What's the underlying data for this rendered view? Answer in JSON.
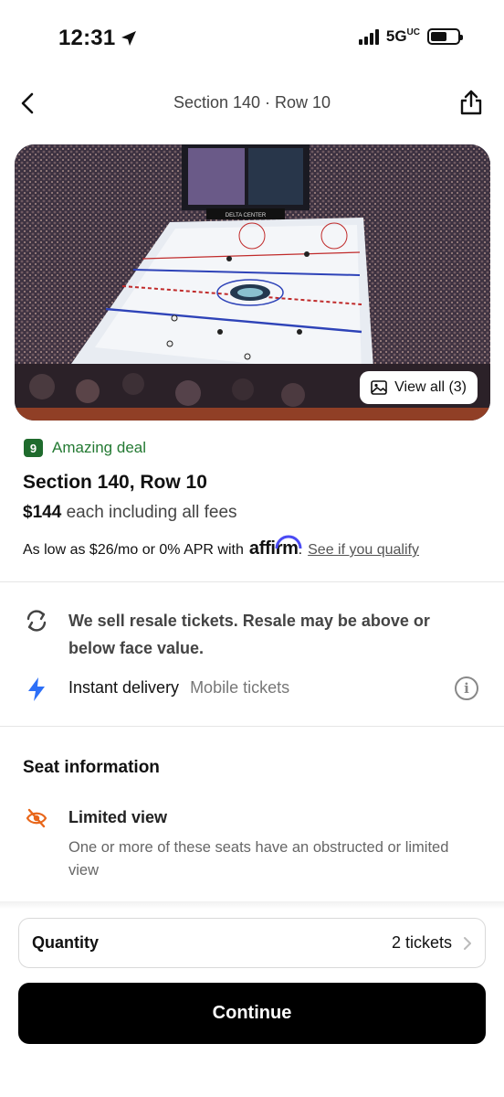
{
  "status_bar": {
    "time": "12:31",
    "network": "5G",
    "network_suffix": "UC",
    "icons": [
      "location-arrow-icon",
      "signal-bars-icon",
      "battery-icon"
    ]
  },
  "header": {
    "title": "Section 140 · Row 10",
    "back_icon": "chevron-left-icon",
    "share_icon": "share-icon"
  },
  "gallery": {
    "view_all_label": "View all (3)",
    "gallery_icon": "image-gallery-icon",
    "arena_sign": "DELTA CENTER"
  },
  "deal": {
    "score": "9",
    "label": "Amazing deal",
    "color": "#247a33"
  },
  "listing": {
    "title": "Section 140, Row 10",
    "price": "$144",
    "price_suffix": "each including all fees"
  },
  "financing": {
    "text": "As low as $26/mo or 0% APR with",
    "brand": "affirm",
    "period": ".",
    "link": "See if you qualify"
  },
  "features": {
    "resale_icon": "refresh-icon",
    "resale_text": "We sell resale tickets. Resale may be above or below face value.",
    "delivery_icon": "lightning-bolt-icon",
    "delivery_label": "Instant delivery",
    "delivery_type": "Mobile tickets",
    "info_glyph": "i"
  },
  "seat_info": {
    "heading": "Seat information",
    "limited_icon": "obstructed-view-icon",
    "limited_title": "Limited view",
    "limited_desc": "One or more of these seats have an obstructed or limited view"
  },
  "checkout": {
    "quantity_label": "Quantity",
    "quantity_value": "2 tickets",
    "continue_label": "Continue"
  },
  "colors": {
    "accent_green": "#247a33",
    "bolt_blue": "#2d6ff7",
    "warning_orange": "#e8671b",
    "button_black": "#000000"
  }
}
